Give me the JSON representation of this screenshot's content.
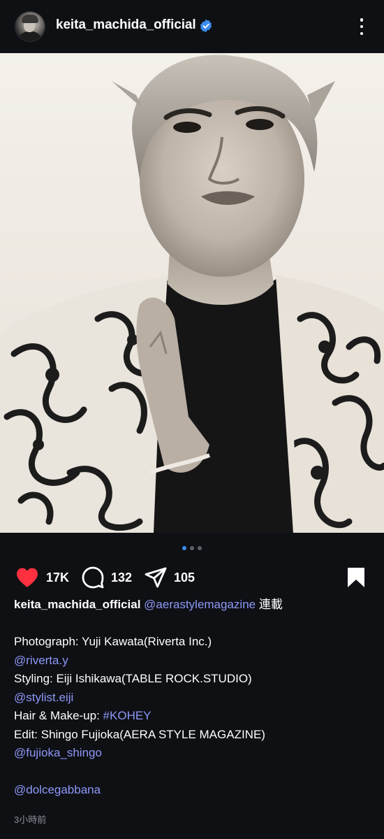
{
  "header": {
    "username": "keita_machida_official",
    "verified_icon": "verified-badge-icon",
    "more_icon": "more-vertical-icon"
  },
  "post": {
    "image_description_icon": "post-photo",
    "carousel": {
      "count": 3,
      "active_index": 0
    }
  },
  "actions": {
    "like_count": "17K",
    "comment_count": "132",
    "share_count": "105",
    "liked": true,
    "like_color": "#ff3040"
  },
  "caption": {
    "author": "keita_machida_official",
    "first_mention": "@aerastylemagazine",
    "first_suffix": " 連載",
    "lines": [
      {
        "label": "Photograph: Yuji Kawata(Riverta Inc.)"
      },
      {
        "mention": "@riverta.y"
      },
      {
        "label": "Styling: Eiji Ishikawa(TABLE ROCK.STUDIO)"
      },
      {
        "mention": "@stylist.eiji"
      },
      {
        "label_prefix": "Hair & Make-up: ",
        "hashtag": "#KOHEY"
      },
      {
        "label": "Edit: Shingo Fujioka(AERA STYLE MAGAZINE)"
      },
      {
        "mention": "@fujioka_shingo"
      },
      {
        "mention": "@dolcegabbana"
      }
    ]
  },
  "timestamp": "3小時前",
  "colors": {
    "background": "#0e1014",
    "mention": "#8e98f7",
    "accent_dot": "#3b8cf0",
    "verified": "#3b8cf0"
  }
}
